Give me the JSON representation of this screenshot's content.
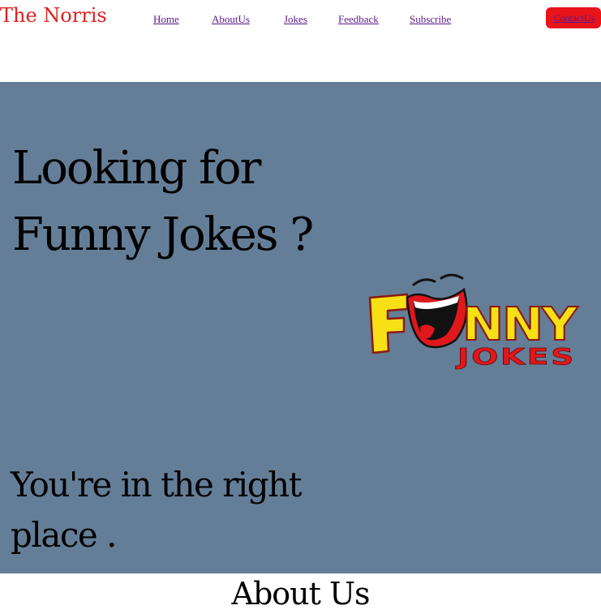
{
  "nav": {
    "brand": "The Norris",
    "links": [
      "Home",
      "AboutUs",
      "Jokes",
      "Feedback",
      "Subscribe"
    ],
    "contact_label": "ContactUs"
  },
  "hero": {
    "heading": "Looking for Funny Jokes ?",
    "subheading": "You're in the right place .",
    "logo_word": "FUNNY",
    "logo_subword": "JOKES"
  },
  "about": {
    "title": "About Us"
  },
  "colors": {
    "brand": "#e0201f",
    "link": "#5b1a8b",
    "contact_button": "#e8141a",
    "hero_background": "#647e98",
    "logo_yellow": "#f7e016",
    "logo_red": "#e0181c"
  }
}
